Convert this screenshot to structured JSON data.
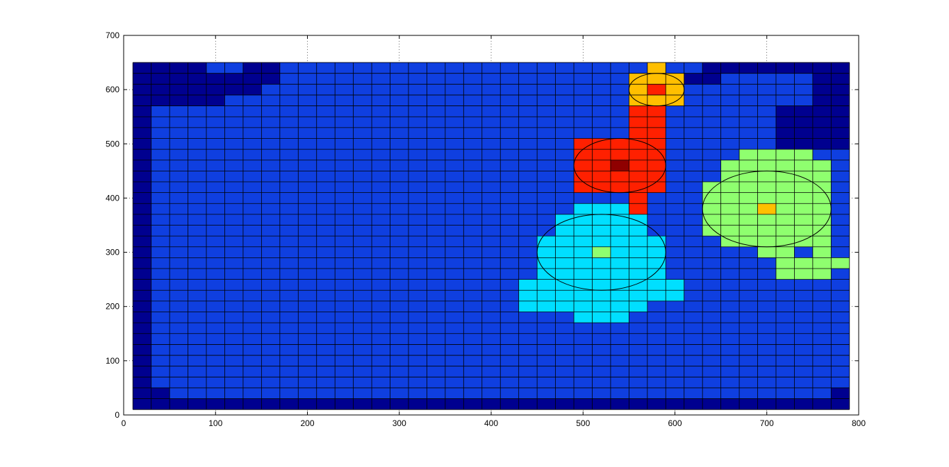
{
  "chart_data": {
    "type": "heatmap",
    "title": "",
    "xlabel": "",
    "ylabel": "",
    "xlim": [
      0,
      800
    ],
    "ylim": [
      0,
      700
    ],
    "grid": "on (dotted)",
    "xticks": [
      "0",
      "100",
      "200",
      "300",
      "400",
      "500",
      "600",
      "700",
      "800"
    ],
    "yticks": [
      "0",
      "100",
      "200",
      "300",
      "400",
      "500",
      "600",
      "700"
    ],
    "cell_size": 20,
    "x_range": [
      10,
      790
    ],
    "y_range": [
      10,
      650
    ],
    "background_level": 1,
    "levels": {
      "0": "#00008F",
      "1": "#0F3FE0",
      "2": "#00DFFF",
      "3": "#8FFF6F",
      "4": "#FFBF00",
      "5": "#FF2000",
      "6": "#8F0000"
    },
    "patches": [
      {
        "level": 0,
        "rects": [
          [
            10,
            570,
            30,
            650
          ],
          [
            30,
            570,
            90,
            650
          ],
          [
            90,
            570,
            110,
            630
          ],
          [
            110,
            590,
            130,
            630
          ],
          [
            130,
            590,
            150,
            650
          ],
          [
            150,
            610,
            170,
            650
          ]
        ]
      },
      {
        "level": 0,
        "rects": [
          [
            10,
            30,
            30,
            570
          ],
          [
            10,
            10,
            50,
            50
          ],
          [
            50,
            10,
            790,
            30
          ],
          [
            650,
            630,
            790,
            650
          ],
          [
            610,
            610,
            650,
            630
          ],
          [
            630,
            630,
            650,
            650
          ],
          [
            750,
            570,
            790,
            630
          ],
          [
            710,
            490,
            790,
            570
          ],
          [
            770,
            30,
            790,
            50
          ]
        ]
      },
      {
        "level": 4,
        "rects": [
          [
            570,
            630,
            590,
            650
          ],
          [
            550,
            570,
            610,
            630
          ]
        ]
      },
      {
        "level": 5,
        "rects": [
          [
            570,
            590,
            590,
            610
          ],
          [
            550,
            490,
            590,
            570
          ],
          [
            490,
            410,
            570,
            510
          ],
          [
            570,
            410,
            590,
            490
          ],
          [
            550,
            370,
            570,
            410
          ]
        ]
      },
      {
        "level": 6,
        "rects": [
          [
            530,
            450,
            550,
            470
          ]
        ]
      },
      {
        "level": 2,
        "rects": [
          [
            490,
            370,
            550,
            390
          ],
          [
            470,
            330,
            570,
            370
          ],
          [
            450,
            250,
            590,
            330
          ],
          [
            430,
            230,
            610,
            250
          ],
          [
            430,
            190,
            570,
            230
          ],
          [
            490,
            170,
            550,
            190
          ],
          [
            570,
            210,
            610,
            230
          ]
        ]
      },
      {
        "level": 3,
        "rects": [
          [
            510,
            290,
            530,
            310
          ]
        ]
      },
      {
        "level": 3,
        "rects": [
          [
            670,
            470,
            750,
            490
          ],
          [
            650,
            430,
            770,
            470
          ],
          [
            630,
            330,
            770,
            430
          ],
          [
            650,
            310,
            750,
            330
          ],
          [
            690,
            290,
            730,
            310
          ],
          [
            710,
            250,
            770,
            290
          ],
          [
            730,
            270,
            790,
            290
          ],
          [
            750,
            290,
            770,
            330
          ]
        ]
      },
      {
        "level": 4,
        "rects": [
          [
            690,
            370,
            710,
            390
          ]
        ]
      }
    ],
    "ellipses": [
      {
        "cx": 580,
        "cy": 600,
        "rx": 30,
        "ry": 30
      },
      {
        "cx": 540,
        "cy": 460,
        "rx": 50,
        "ry": 50
      },
      {
        "cx": 520,
        "cy": 300,
        "rx": 70,
        "ry": 70
      },
      {
        "cx": 700,
        "cy": 380,
        "rx": 70,
        "ry": 70
      }
    ]
  }
}
